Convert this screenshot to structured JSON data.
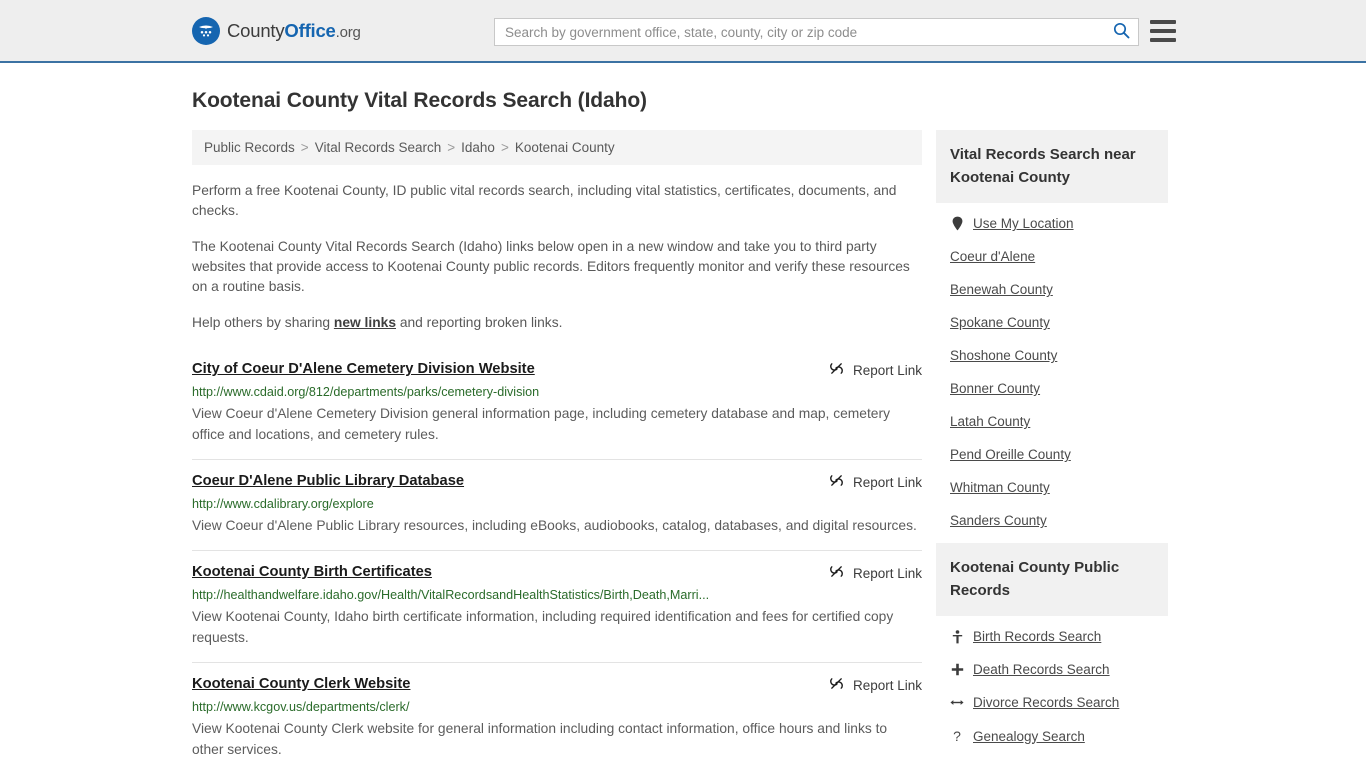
{
  "header": {
    "logo": {
      "icon": "eagle-shield-icon",
      "part1": "County",
      "part2": "Office",
      "part3": ".org"
    },
    "search": {
      "placeholder": "Search by government office, state, county, city or zip code",
      "value": "",
      "search_icon": "search-icon"
    },
    "menu_icon": "hamburger-menu-icon"
  },
  "page": {
    "title": "Kootenai County Vital Records Search (Idaho)"
  },
  "breadcrumb": {
    "separator": ">",
    "items": [
      {
        "label": "Public Records"
      },
      {
        "label": "Vital Records Search"
      },
      {
        "label": "Idaho"
      },
      {
        "label": "Kootenai County"
      }
    ]
  },
  "intro": {
    "paragraph1": "Perform a free Kootenai County, ID public vital records search, including vital statistics, certificates, documents, and checks.",
    "paragraph2": "The Kootenai County Vital Records Search (Idaho) links below open in a new window and take you to third party websites that provide access to Kootenai County public records. Editors frequently monitor and verify these resources on a routine basis.",
    "paragraph3_before": "Help others by sharing ",
    "paragraph3_link": "new links",
    "paragraph3_after": " and reporting broken links."
  },
  "results": {
    "report_label": "Report Link",
    "report_icon": "broken-link-icon",
    "items": [
      {
        "title": "City of Coeur D'Alene Cemetery Division Website",
        "url": "http://www.cdaid.org/812/departments/parks/cemetery-division",
        "description": "View Coeur d'Alene Cemetery Division general information page, including cemetery database and map, cemetery office and locations, and cemetery rules."
      },
      {
        "title": "Coeur D'Alene Public Library Database",
        "url": "http://www.cdalibrary.org/explore",
        "description": "View Coeur d'Alene Public Library resources, including eBooks, audiobooks, catalog, databases, and digital resources."
      },
      {
        "title": "Kootenai County Birth Certificates",
        "url": "http://healthandwelfare.idaho.gov/Health/VitalRecordsandHealthStatistics/Birth,Death,Marri...",
        "description": "View Kootenai County, Idaho birth certificate information, including required identification and fees for certified copy requests."
      },
      {
        "title": "Kootenai County Clerk Website",
        "url": "http://www.kcgov.us/departments/clerk/",
        "description": "View Kootenai County Clerk website for general information including contact information, office hours and links to other services."
      }
    ]
  },
  "sidebar": {
    "nearby": {
      "heading": "Vital Records Search near Kootenai County",
      "items": [
        {
          "label": "Use My Location",
          "icon": "map-pin-icon"
        },
        {
          "label": "Coeur d'Alene",
          "icon": ""
        },
        {
          "label": "Benewah County",
          "icon": ""
        },
        {
          "label": "Spokane County",
          "icon": ""
        },
        {
          "label": "Shoshone County",
          "icon": ""
        },
        {
          "label": "Bonner County",
          "icon": ""
        },
        {
          "label": "Latah County",
          "icon": ""
        },
        {
          "label": "Pend Oreille County",
          "icon": ""
        },
        {
          "label": "Whitman County",
          "icon": ""
        },
        {
          "label": "Sanders County",
          "icon": ""
        }
      ]
    },
    "public_records": {
      "heading": "Kootenai County Public Records",
      "items": [
        {
          "label": "Birth Records Search",
          "icon": "baby-icon"
        },
        {
          "label": "Death Records Search",
          "icon": "plus-cross-icon"
        },
        {
          "label": "Divorce Records Search",
          "icon": "left-right-arrow-icon"
        },
        {
          "label": "Genealogy Search",
          "icon": "question-mark-icon"
        }
      ]
    }
  }
}
